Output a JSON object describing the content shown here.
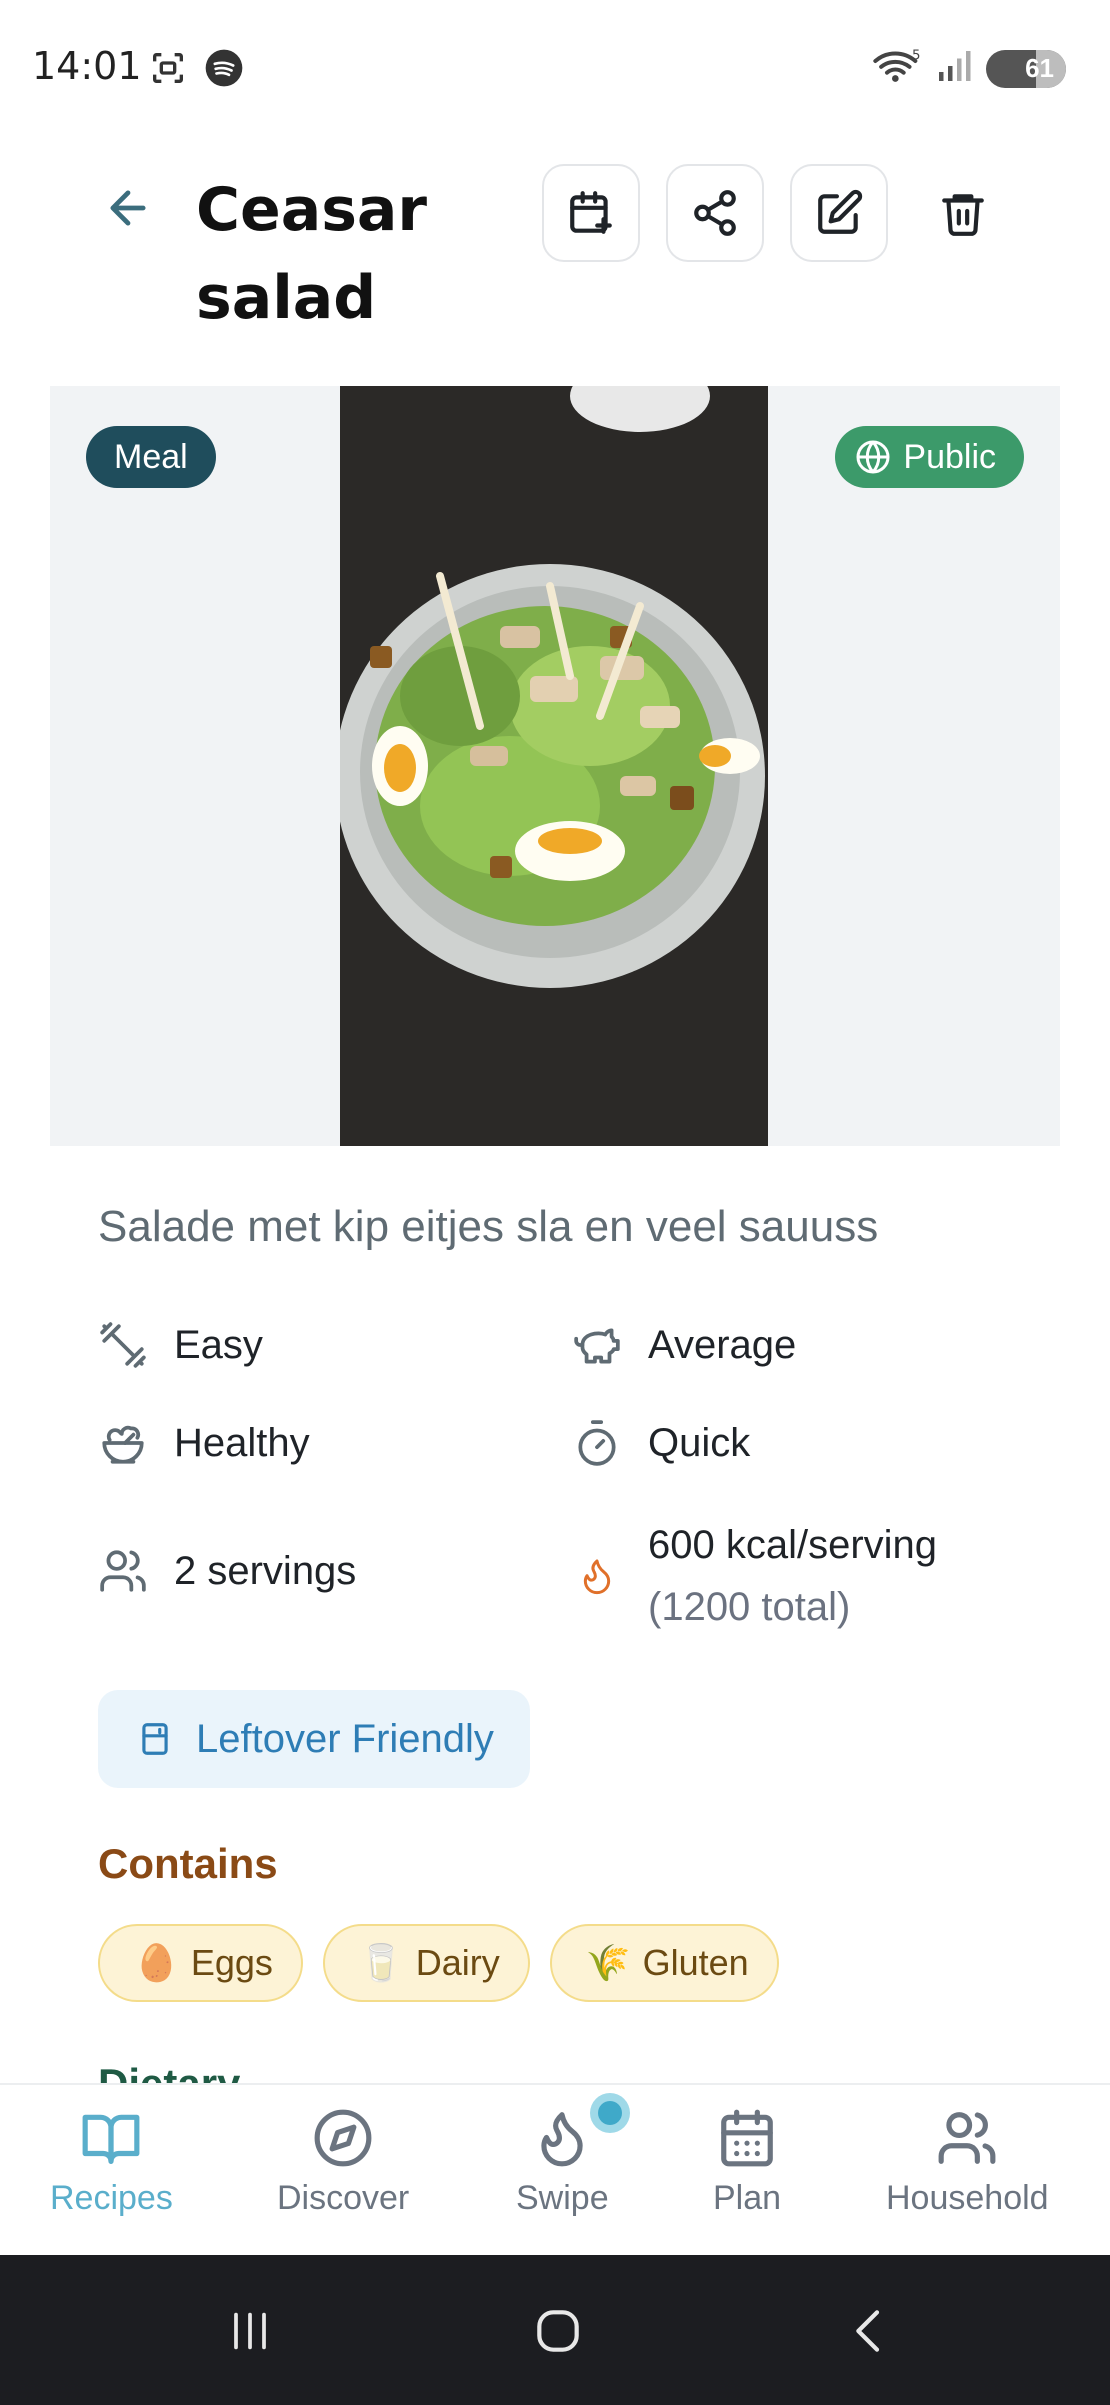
{
  "status_bar": {
    "time": "14:01",
    "battery": "61",
    "icons_left": [
      "screenshot-icon",
      "spotify-icon"
    ],
    "icons_right": [
      "wifi-icon",
      "signal-icon",
      "battery-icon"
    ]
  },
  "header": {
    "title": "Ceasar salad",
    "actions": [
      "calendar-add-icon",
      "share-icon",
      "edit-icon",
      "trash-icon"
    ]
  },
  "hero": {
    "badge_type": "Meal",
    "badge_visibility": "Public"
  },
  "description": "Salade met kip eitjes sla en veel sauuss",
  "info": {
    "difficulty": "Easy",
    "cost": "Average",
    "health": "Healthy",
    "speed": "Quick",
    "servings": "2 servings",
    "kcal": "600 kcal/serving",
    "kcal_total": "(1200 total)"
  },
  "leftover": "Leftover Friendly",
  "contains": {
    "title": "Contains",
    "items": [
      {
        "emoji": "🥚",
        "label": "Eggs"
      },
      {
        "emoji": "🥛",
        "label": "Dairy"
      },
      {
        "emoji": "🌾",
        "label": "Gluten"
      }
    ]
  },
  "dietary_title": "Dietary",
  "nav": {
    "items": [
      {
        "label": "Recipes",
        "icon": "book-icon",
        "active": true
      },
      {
        "label": "Discover",
        "icon": "compass-icon",
        "active": false
      },
      {
        "label": "Swipe",
        "icon": "flame-icon",
        "active": false
      },
      {
        "label": "Plan",
        "icon": "calendar-icon",
        "active": false
      },
      {
        "label": "Household",
        "icon": "users-icon",
        "active": false
      }
    ]
  },
  "colors": {
    "meal_badge": "#1f4d5c",
    "public_badge": "#3c9a6a",
    "accent": "#5aaecb",
    "contains_title": "#8a4a16"
  }
}
